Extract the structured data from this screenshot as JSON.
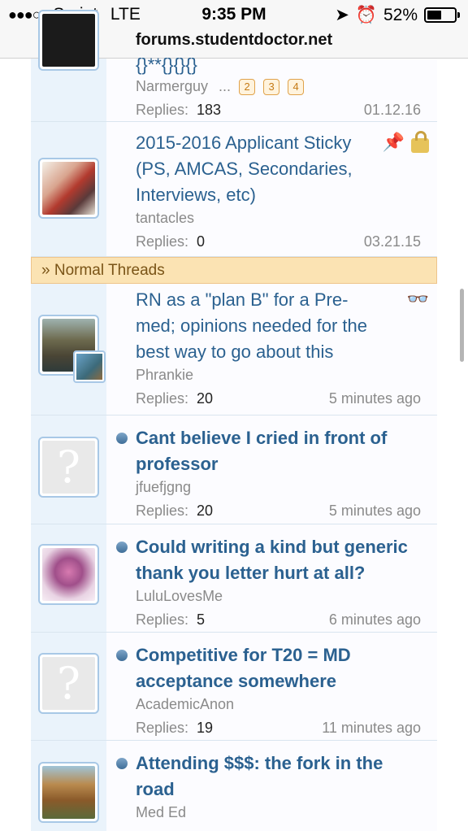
{
  "status_bar": {
    "carrier": "Sprint",
    "network": "LTE",
    "time": "9:35 PM",
    "battery": "52%",
    "battery_level": 0.52
  },
  "url_bar": {
    "domain": "forums.studentdoctor.net"
  },
  "sticky_threads": [
    {
      "title": "{}**{}{}{}",
      "author": "Narmerguy",
      "ellipsis": "...",
      "pages": [
        "2",
        "3",
        "4"
      ],
      "replies_label": "Replies:",
      "replies": "183",
      "date": "01.12.16"
    },
    {
      "title_lines": [
        "2015-2016 Applicant Sticky",
        "(PS, AMCAS, Secondaries,",
        "Interviews, etc)"
      ],
      "author": "tantacles",
      "replies_label": "Replies:",
      "replies": "0",
      "date": "03.21.15",
      "icons": [
        "pin-icon",
        "lock-icon"
      ]
    }
  ],
  "section_header": "Normal Threads",
  "section_prefix": "»",
  "normal_threads": [
    {
      "title_lines": [
        "RN as a \"plan B\" for a Pre-",
        "med; opinions needed for the",
        "best way to go about this"
      ],
      "author": "Phrankie",
      "replies_label": "Replies:",
      "replies": "20",
      "date": "5 minutes ago"
    },
    {
      "title_lines": [
        "Cant believe I cried in front of",
        "professor"
      ],
      "author": "jfuefjgng",
      "replies_label": "Replies:",
      "replies": "20",
      "date": "5 minutes ago"
    },
    {
      "title_lines": [
        "Could writing a kind but generic",
        "thank you letter hurt at all?"
      ],
      "author": "LuluLovesMe",
      "replies_label": "Replies:",
      "replies": "5",
      "date": "6 minutes ago"
    },
    {
      "title_lines": [
        "Competitive for T20 = MD",
        "acceptance somewhere"
      ],
      "author": "AcademicAnon",
      "replies_label": "Replies:",
      "replies": "19",
      "date": "11 minutes ago"
    },
    {
      "title_lines": [
        "Attending $$$: the fork in the",
        "road"
      ],
      "author": "Med Ed"
    }
  ],
  "colors": {
    "link": "#2b6190",
    "gutter": "#eaf3fb",
    "section_bg": "#fbe3b3",
    "unread_dot": "#4f7ca6"
  }
}
